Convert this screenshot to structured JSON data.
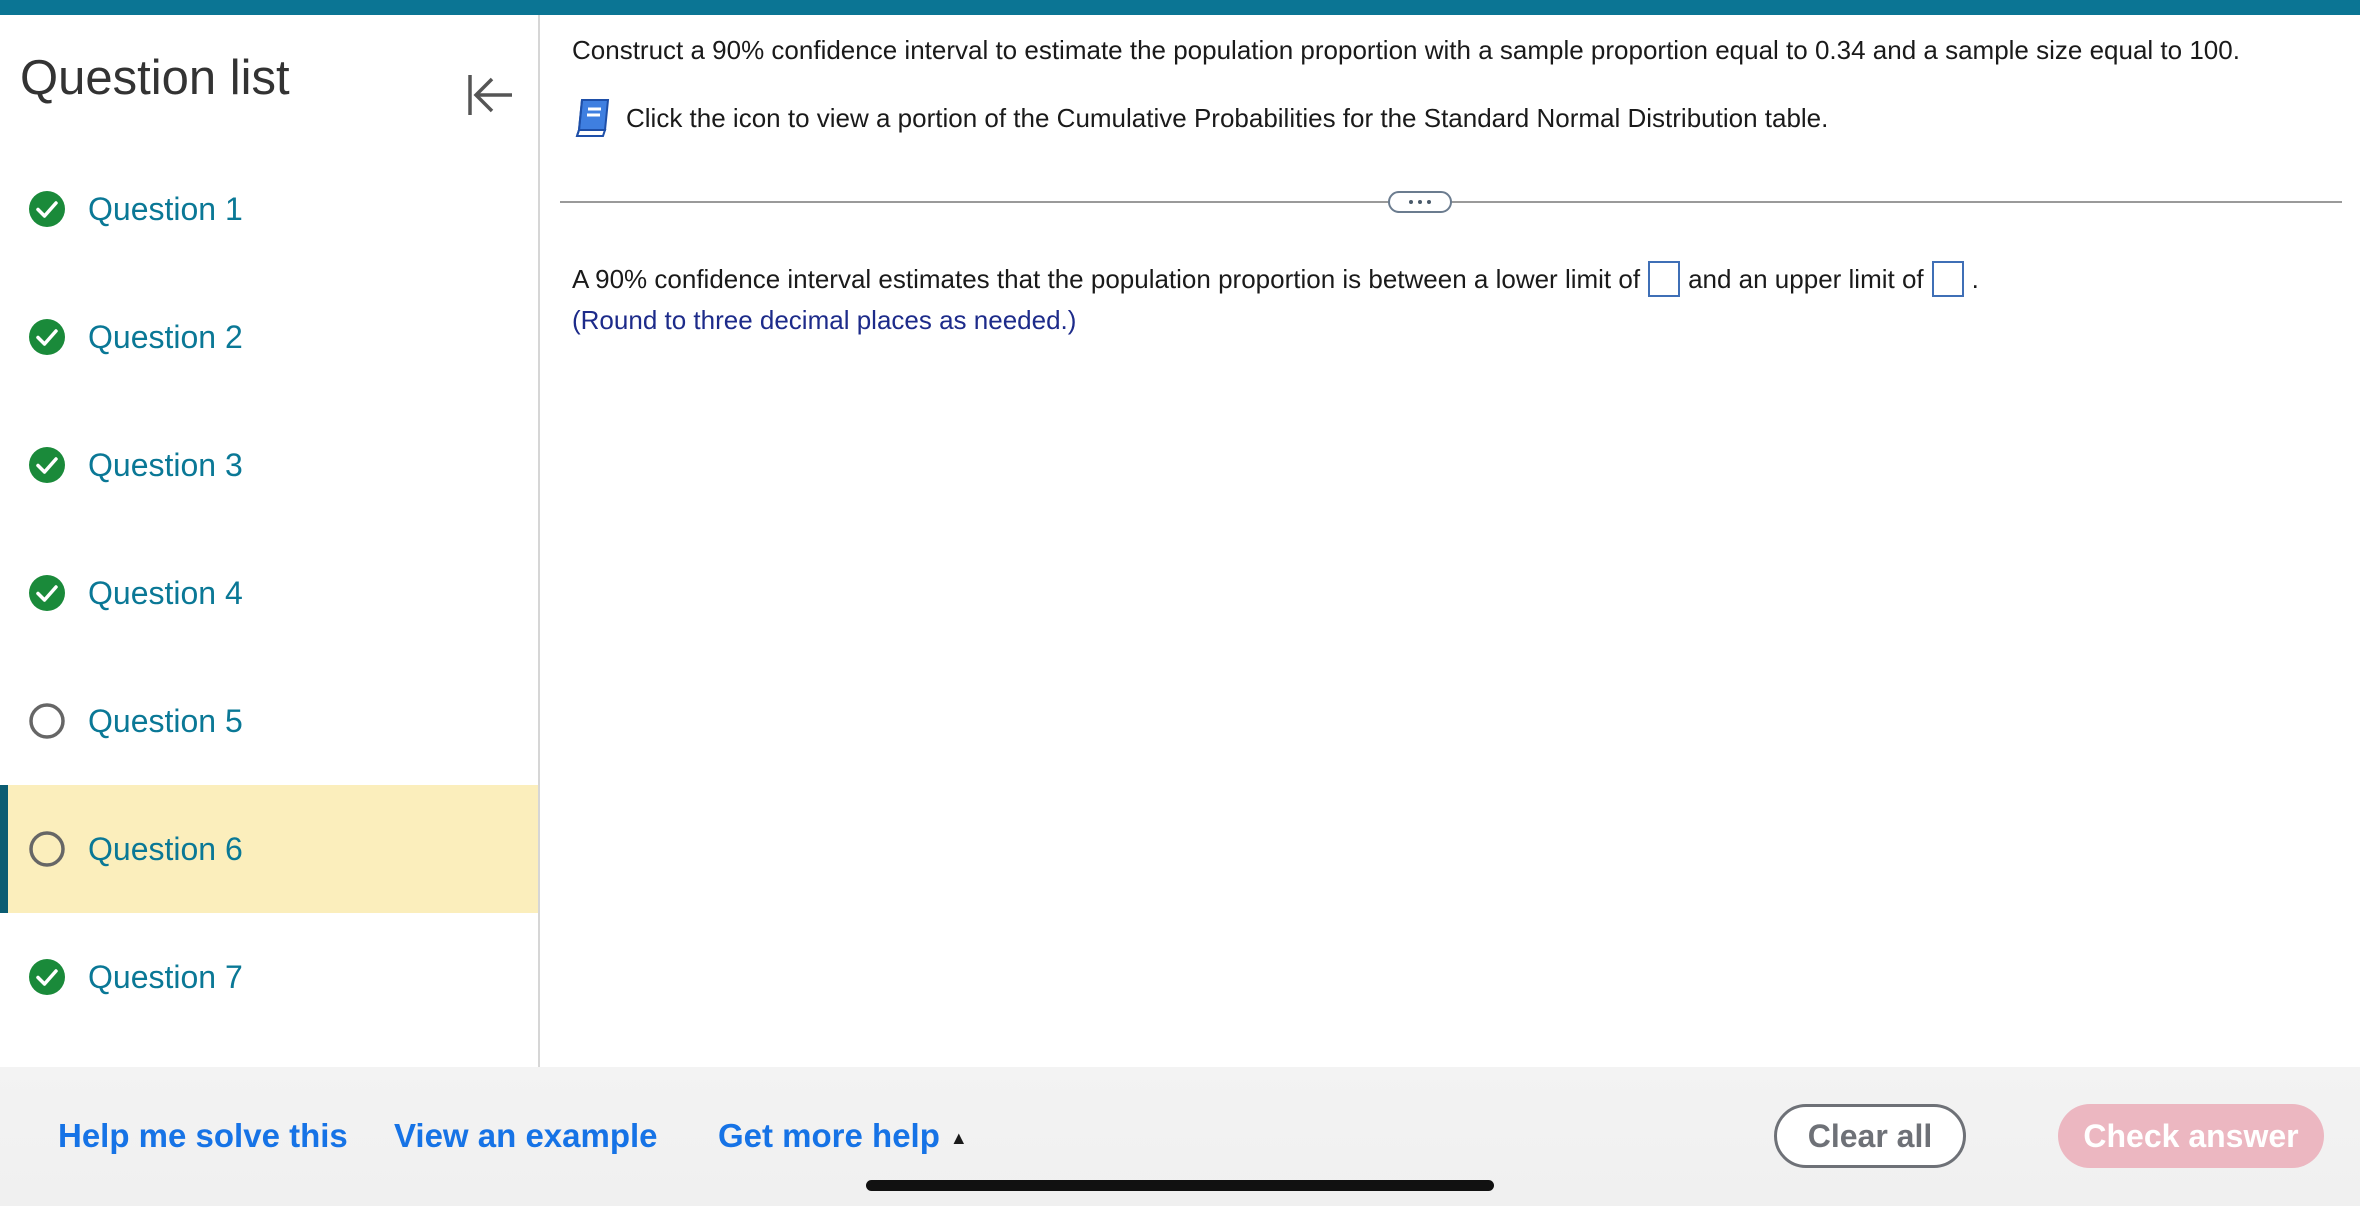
{
  "sidebar": {
    "title": "Question list",
    "questions": [
      {
        "label": "Question 1",
        "status": "complete"
      },
      {
        "label": "Question 2",
        "status": "complete"
      },
      {
        "label": "Question 3",
        "status": "complete"
      },
      {
        "label": "Question 4",
        "status": "complete"
      },
      {
        "label": "Question 5",
        "status": "incomplete"
      },
      {
        "label": "Question 6",
        "status": "incomplete",
        "active": true
      },
      {
        "label": "Question 7",
        "status": "complete"
      }
    ]
  },
  "question": {
    "instructions": "Construct a 90% confidence interval to estimate the population proportion with a sample proportion equal to 0.34 and a sample size equal to 100.",
    "table_link_text": "Click the icon to view a portion of the Cumulative Probabilities for the Standard Normal Distribution table.",
    "answer_prefix": "A 90% confidence interval estimates that the population proportion is between a lower limit of",
    "answer_middle": "and an upper limit of",
    "answer_suffix": ".",
    "lower_limit_value": "",
    "upper_limit_value": "",
    "rounding_note": "(Round to three decimal places as needed.)"
  },
  "footer": {
    "help_solve": "Help me solve this",
    "view_example": "View an example",
    "more_help": "Get more help",
    "more_help_caret": "▲",
    "clear_all": "Clear all",
    "check_answer": "Check answer"
  },
  "colors": {
    "accent": "#0b7594",
    "link": "#1673e6",
    "complete": "#1a8a3a",
    "active_row": "#fbeebc",
    "check_button": "#ecb7c1"
  }
}
